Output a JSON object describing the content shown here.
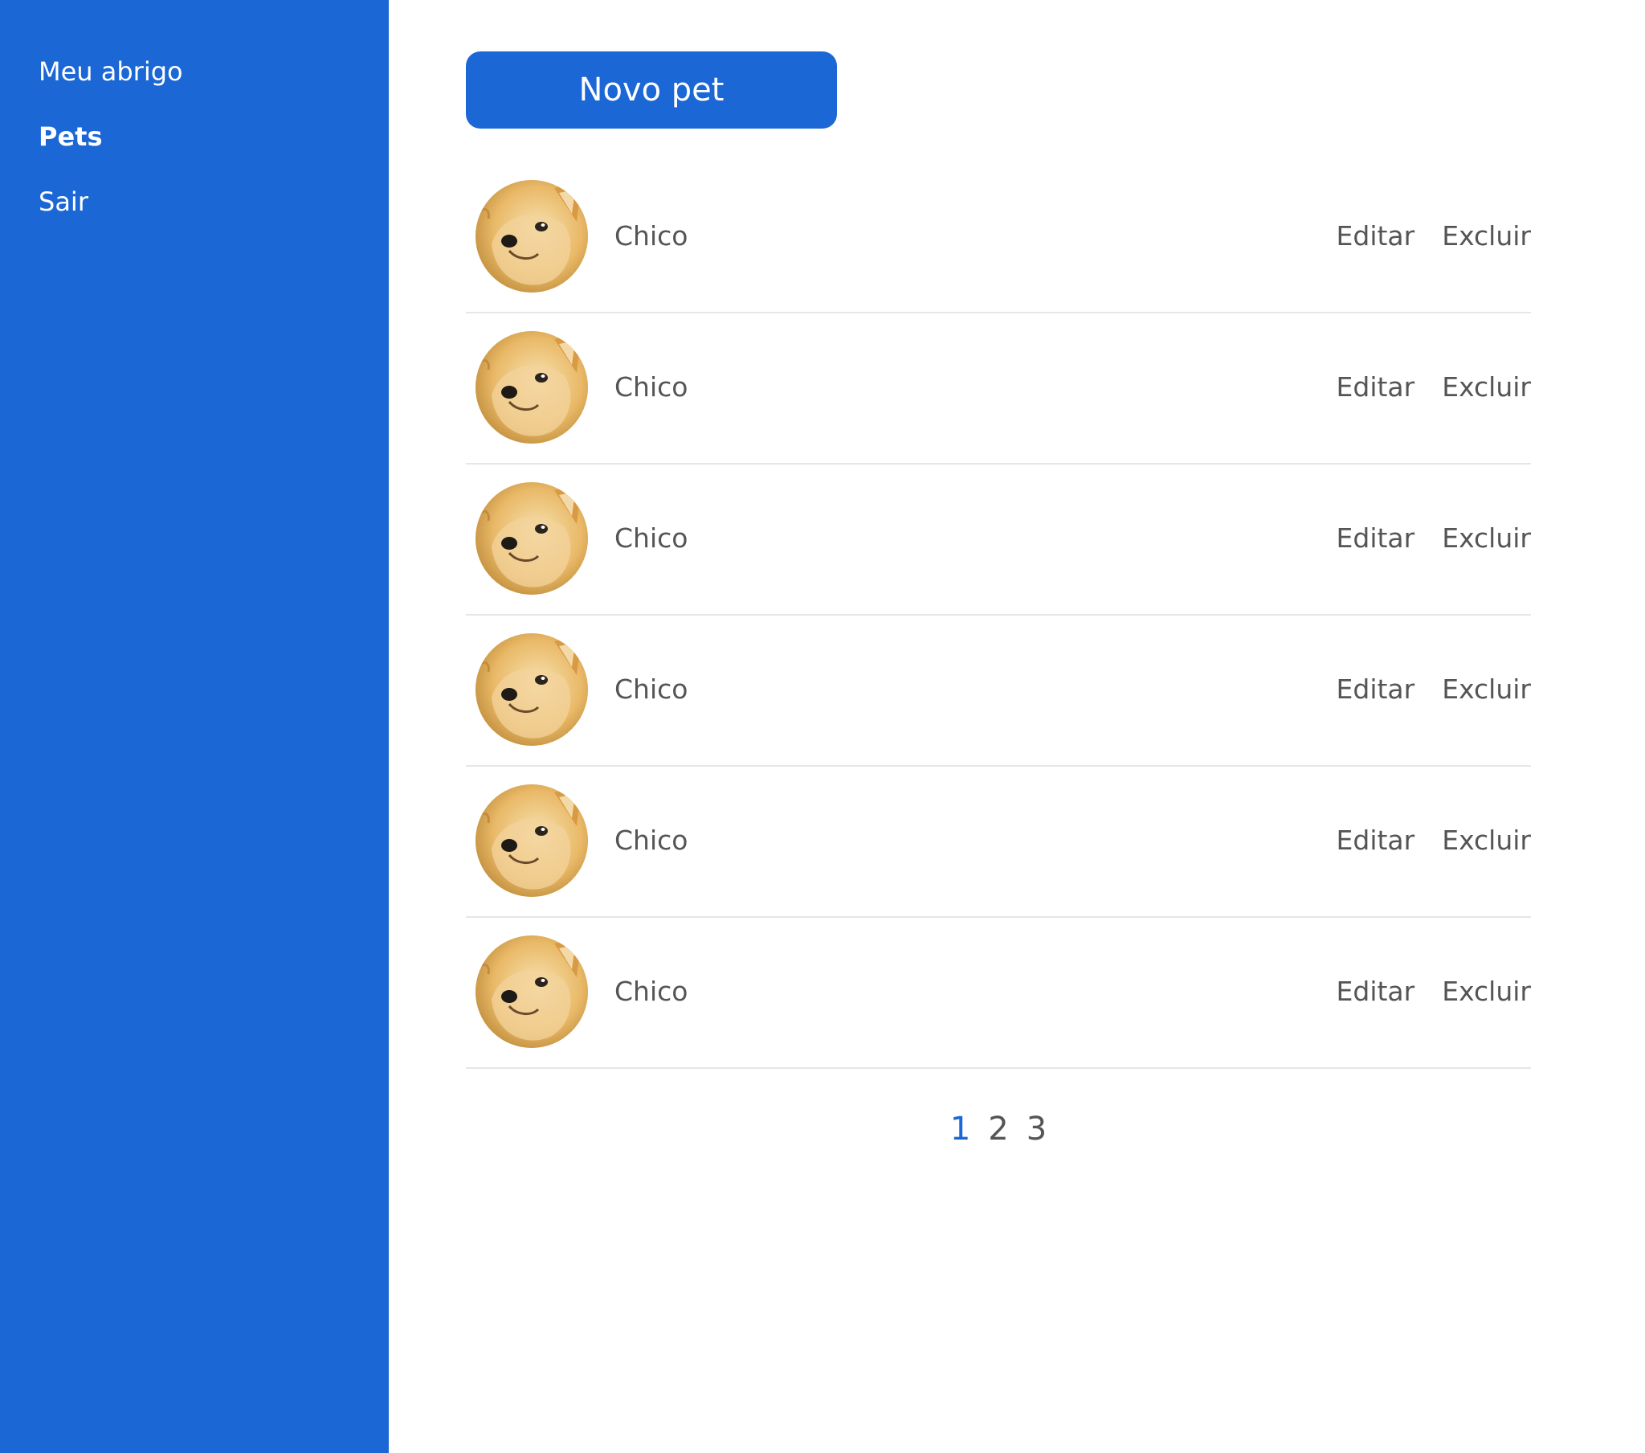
{
  "colors": {
    "accent": "#1a67d5",
    "text": "#555555",
    "divider": "#e6e6e6",
    "white": "#ffffff"
  },
  "sidebar": {
    "items": [
      {
        "label": "Meu abrigo",
        "active": false
      },
      {
        "label": "Pets",
        "active": true
      },
      {
        "label": "Sair",
        "active": false
      }
    ]
  },
  "main": {
    "new_pet_label": "Novo pet",
    "pets": [
      {
        "name": "Chico",
        "avatar_icon": "shiba-dog-photo",
        "edit_label": "Editar",
        "delete_label": "Excluir"
      },
      {
        "name": "Chico",
        "avatar_icon": "shiba-dog-photo",
        "edit_label": "Editar",
        "delete_label": "Excluir"
      },
      {
        "name": "Chico",
        "avatar_icon": "shiba-dog-photo",
        "edit_label": "Editar",
        "delete_label": "Excluir"
      },
      {
        "name": "Chico",
        "avatar_icon": "shiba-dog-photo",
        "edit_label": "Editar",
        "delete_label": "Excluir"
      },
      {
        "name": "Chico",
        "avatar_icon": "shiba-dog-photo",
        "edit_label": "Editar",
        "delete_label": "Excluir"
      },
      {
        "name": "Chico",
        "avatar_icon": "shiba-dog-photo",
        "edit_label": "Editar",
        "delete_label": "Excluir"
      }
    ],
    "pagination": {
      "pages": [
        "1",
        "2",
        "3"
      ],
      "current": "1"
    }
  }
}
